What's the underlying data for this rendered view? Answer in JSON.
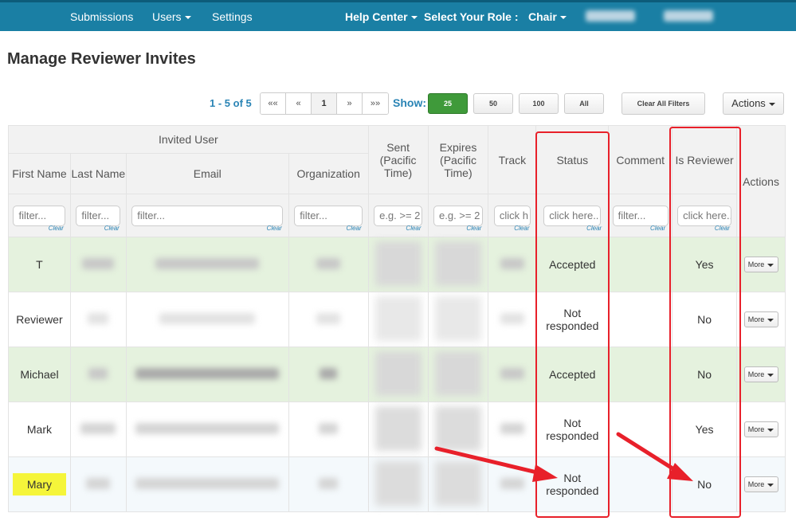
{
  "nav": {
    "submissions": "Submissions",
    "users": "Users",
    "settings": "Settings",
    "help_center": "Help Center",
    "select_role_label": "Select Your Role :",
    "role": "Chair"
  },
  "page_title": "Manage Reviewer Invites",
  "pager": {
    "range": "1 - 5 of 5",
    "first": "««",
    "prev": "«",
    "page": "1",
    "next": "»",
    "last": "»»"
  },
  "show": {
    "label": "Show:",
    "sizes": [
      "25",
      "50",
      "100",
      "All"
    ],
    "selected": "25"
  },
  "toolbar": {
    "clear_filters": "Clear All Filters",
    "actions": "Actions"
  },
  "table": {
    "group_header": "Invited User",
    "columns": {
      "first_name": "First Name",
      "last_name": "Last Name",
      "email": "Email",
      "organization": "Organization",
      "sent": "Sent (Pacific Time)",
      "expires": "Expires (Pacific Time)",
      "track": "Track",
      "status": "Status",
      "comment": "Comment",
      "is_reviewer": "Is Reviewer",
      "actions": "Actions"
    },
    "filters": {
      "text": "filter...",
      "date": "e.g. >= 2",
      "click_short": "click h",
      "click": "click here..",
      "clear": "Clear"
    },
    "rows": [
      {
        "first": "T",
        "status": "Accepted",
        "is_reviewer": "Yes",
        "more": "More"
      },
      {
        "first": "Reviewer",
        "status": "Not responded",
        "is_reviewer": "No",
        "more": "More"
      },
      {
        "first": "Michael",
        "status": "Accepted",
        "is_reviewer": "No",
        "more": "More"
      },
      {
        "first": "Mark",
        "status": "Not responded",
        "is_reviewer": "Yes",
        "more": "More"
      },
      {
        "first": "Mary",
        "status": "Not responded",
        "is_reviewer": "No",
        "more": "More"
      }
    ]
  },
  "colors": {
    "topbar": "#1a7fa4",
    "accepted_row": "#e5f2de",
    "annotation_red": "#e8202a",
    "highlight_yellow": "#f5f53a"
  }
}
